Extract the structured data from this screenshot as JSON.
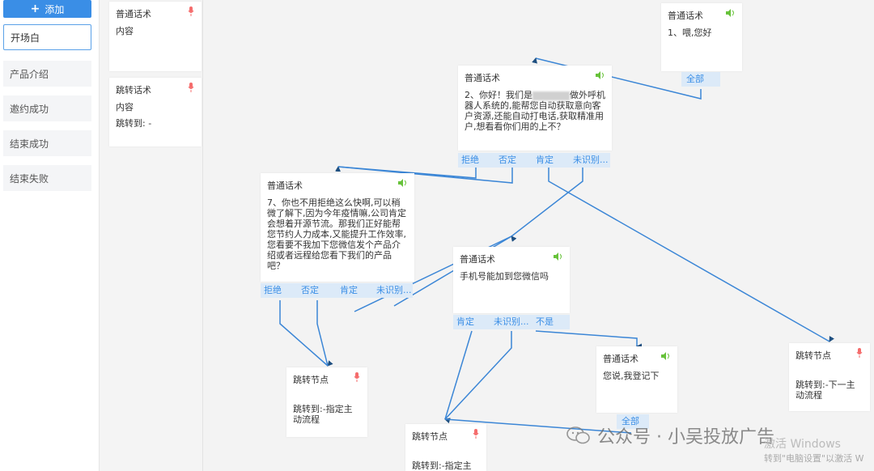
{
  "sidebar": {
    "add_label": "添加",
    "items": [
      {
        "label": "开场白",
        "active": true
      },
      {
        "label": "产品介绍",
        "active": false
      },
      {
        "label": "邀约成功",
        "active": false
      },
      {
        "label": "结束成功",
        "active": false
      },
      {
        "label": "结束失败",
        "active": false
      }
    ]
  },
  "column": {
    "card1": {
      "title": "普通话术",
      "content": "内容"
    },
    "card2": {
      "title": "跳转话术",
      "content": "内容",
      "jump": "跳转到: -"
    }
  },
  "nodes": {
    "n1": {
      "title": "普通话术",
      "text": "1、喂,您好",
      "branches": [
        "全部"
      ]
    },
    "n2": {
      "title": "普通话术",
      "text_a": "2、你好！我们是",
      "text_b": "做外呼机器人系统的,能帮您自动获取意向客户资源,还能自动打电话,获取精准用户,想看看你们用的上不？",
      "branches": [
        "拒绝",
        "否定",
        "肯定",
        "未识别..."
      ]
    },
    "n3": {
      "title": "普通话术",
      "text": "7、你也不用拒绝这么快啊,可以稍微了解下,因为今年疫情嘛,公司肯定会想着开源节流。那我们正好能帮您节约人力成本,又能提升工作效率,您看要不我加下您微信发个产品介绍或者远程给您看下我们的产品吧？",
      "branches": [
        "拒绝",
        "否定",
        "肯定",
        "未识别..."
      ]
    },
    "n4": {
      "title": "普通话术",
      "text": "手机号能加到您微信吗",
      "branches": [
        "肯定",
        "未识别...",
        "不是"
      ]
    },
    "n5": {
      "title": "普通话术",
      "text": "您说,我登记下",
      "branches": [
        "全部"
      ]
    },
    "j1": {
      "title": "跳转节点",
      "text": "跳转到:-指定主动流程"
    },
    "j2": {
      "title": "跳转节点",
      "text": "跳转到:-下一主动流程"
    },
    "j3": {
      "title": "跳转节点",
      "text": "跳转到:-指定主"
    }
  },
  "watermark": "公众号 · 小吴投放广告",
  "activate": {
    "line1": "激活 Windows",
    "line2": "转到\"电脑设置\"以激活 W"
  },
  "colors": {
    "accent": "#3a8ee6",
    "line": "#3b86d6",
    "speaker": "#67c23a",
    "mic": "#f56c6c"
  }
}
